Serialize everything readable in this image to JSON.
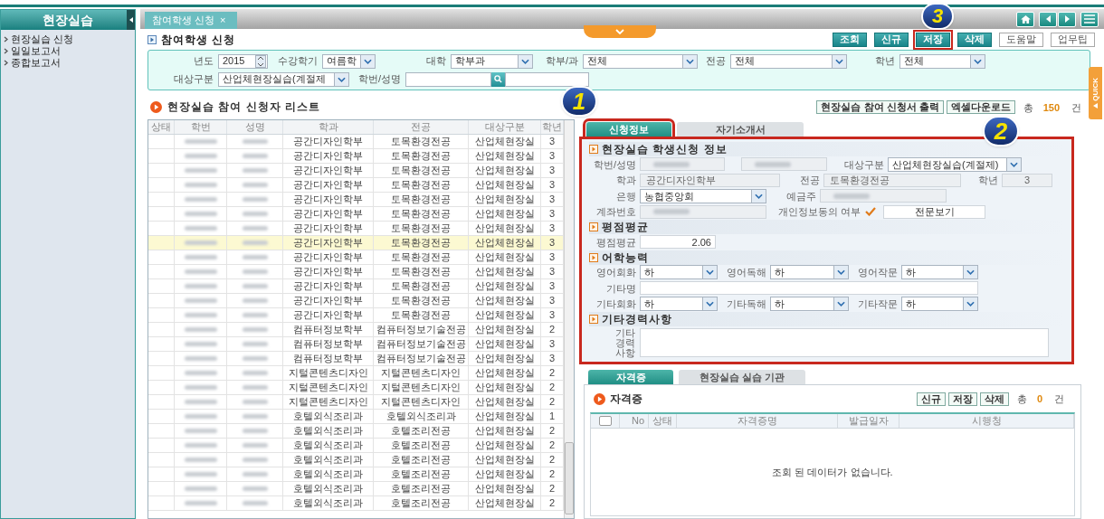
{
  "sidebar": {
    "title": "현장실습",
    "items": [
      {
        "label": "현장실습 신청"
      },
      {
        "label": "일일보고서"
      },
      {
        "label": "종합보고서"
      }
    ]
  },
  "page_tabs": [
    {
      "label": "참여학생 신청",
      "close": "×"
    }
  ],
  "page_title": "참여학생 신청",
  "toolbar_buttons": [
    {
      "label": "조회",
      "kind": "primary",
      "highlighted": false
    },
    {
      "label": "신규",
      "kind": "primary",
      "highlighted": false
    },
    {
      "label": "저장",
      "kind": "primary",
      "highlighted": true
    },
    {
      "label": "삭제",
      "kind": "primary",
      "highlighted": false
    },
    {
      "label": "도움말",
      "kind": "plain",
      "highlighted": false
    },
    {
      "label": "업무팁",
      "kind": "plain",
      "highlighted": false
    }
  ],
  "filters": [
    [
      {
        "label": "년도",
        "kind": "spinner",
        "value": "2015"
      },
      {
        "label": "수강학기",
        "kind": "select",
        "value": "여름학"
      },
      {
        "label": "대학",
        "kind": "select",
        "value": "학부과"
      },
      {
        "label": "학부/과",
        "kind": "select",
        "value": "전체"
      },
      {
        "label": "전공",
        "kind": "select",
        "value": "전체"
      },
      {
        "label": "학년",
        "kind": "select",
        "value": "전체"
      }
    ],
    [
      {
        "label": "대상구분",
        "kind": "select",
        "value": "산업체현장실습(계절제"
      },
      {
        "label": "학번/성명",
        "kind": "search"
      }
    ]
  ],
  "list": {
    "title": "현장실습 참여 신청자 리스트",
    "actions": [
      "현장실습 참여 신청서 출력",
      "엑셀다운로드"
    ],
    "total": {
      "prefix": "총",
      "count": "150",
      "suffix": "건"
    },
    "columns": [
      "상태",
      "학번",
      "성명",
      "학과",
      "전공",
      "대상구분",
      "학년"
    ],
    "rows": [
      {
        "department": "공간디자인학부",
        "major": "토목환경전공",
        "target": "산업체현장실",
        "grade": "3",
        "selected": false
      },
      {
        "department": "공간디자인학부",
        "major": "토목환경전공",
        "target": "산업체현장실",
        "grade": "3",
        "selected": false
      },
      {
        "department": "공간디자인학부",
        "major": "토목환경전공",
        "target": "산업체현장실",
        "grade": "3",
        "selected": false
      },
      {
        "department": "공간디자인학부",
        "major": "토목환경전공",
        "target": "산업체현장실",
        "grade": "3",
        "selected": false
      },
      {
        "department": "공간디자인학부",
        "major": "토목환경전공",
        "target": "산업체현장실",
        "grade": "3",
        "selected": false
      },
      {
        "department": "공간디자인학부",
        "major": "토목환경전공",
        "target": "산업체현장실",
        "grade": "3",
        "selected": false
      },
      {
        "department": "공간디자인학부",
        "major": "토목환경전공",
        "target": "산업체현장실",
        "grade": "3",
        "selected": false
      },
      {
        "department": "공간디자인학부",
        "major": "토목환경전공",
        "target": "산업체현장실",
        "grade": "3",
        "selected": true
      },
      {
        "department": "공간디자인학부",
        "major": "토목환경전공",
        "target": "산업체현장실",
        "grade": "3",
        "selected": false
      },
      {
        "department": "공간디자인학부",
        "major": "토목환경전공",
        "target": "산업체현장실",
        "grade": "3",
        "selected": false
      },
      {
        "department": "공간디자인학부",
        "major": "토목환경전공",
        "target": "산업체현장실",
        "grade": "3",
        "selected": false
      },
      {
        "department": "공간디자인학부",
        "major": "토목환경전공",
        "target": "산업체현장실",
        "grade": "3",
        "selected": false
      },
      {
        "department": "공간디자인학부",
        "major": "토목환경전공",
        "target": "산업체현장실",
        "grade": "3",
        "selected": false
      },
      {
        "department": "컴퓨터정보학부",
        "major": "컴퓨터정보기술전공",
        "target": "산업체현장실",
        "grade": "2",
        "selected": false
      },
      {
        "department": "컴퓨터정보학부",
        "major": "컴퓨터정보기술전공",
        "target": "산업체현장실",
        "grade": "3",
        "selected": false
      },
      {
        "department": "컴퓨터정보학부",
        "major": "컴퓨터정보기술전공",
        "target": "산업체현장실",
        "grade": "3",
        "selected": false
      },
      {
        "department": "지털콘텐츠디자인",
        "major": "지털콘텐츠디자인",
        "target": "산업체현장실",
        "grade": "2",
        "selected": false
      },
      {
        "department": "지털콘텐츠디자인",
        "major": "지털콘텐츠디자인",
        "target": "산업체현장실",
        "grade": "2",
        "selected": false
      },
      {
        "department": "지털콘텐츠디자인",
        "major": "지털콘텐츠디자인",
        "target": "산업체현장실",
        "grade": "2",
        "selected": false
      },
      {
        "department": "호텔외식조리과",
        "major": "호텔외식조리과",
        "target": "산업체현장실",
        "grade": "1",
        "selected": false
      },
      {
        "department": "호텔외식조리과",
        "major": "호텔조리전공",
        "target": "산업체현장실",
        "grade": "2",
        "selected": false
      },
      {
        "department": "호텔외식조리과",
        "major": "호텔조리전공",
        "target": "산업체현장실",
        "grade": "2",
        "selected": false
      },
      {
        "department": "호텔외식조리과",
        "major": "호텔조리전공",
        "target": "산업체현장실",
        "grade": "2",
        "selected": false
      },
      {
        "department": "호텔외식조리과",
        "major": "호텔조리전공",
        "target": "산업체현장실",
        "grade": "2",
        "selected": false
      },
      {
        "department": "호텔외식조리과",
        "major": "호텔조리전공",
        "target": "산업체현장실",
        "grade": "2",
        "selected": false
      },
      {
        "department": "호텔외식조리과",
        "major": "호텔조리전공",
        "target": "산업체현장실",
        "grade": "2",
        "selected": false
      }
    ]
  },
  "detail_tabs": [
    {
      "label": "신청정보",
      "selected": true,
      "highlighted": true
    },
    {
      "label": "자기소개서",
      "selected": false,
      "highlighted": false
    }
  ],
  "form": {
    "highlighted": true,
    "sections": [
      {
        "title": "현장실습 학생신청 정보",
        "rows": [
          [
            {
              "label": "학번/성명",
              "kind": "redacted"
            },
            {
              "kind": "redacted"
            },
            {
              "label": "대상구분",
              "kind": "select",
              "value": "산업체현장실습(계절제)"
            }
          ],
          [
            {
              "label": "학과",
              "kind": "readonly",
              "value": "공간디자인학부"
            },
            {
              "label": "전공",
              "kind": "readonly",
              "value": "토목환경전공"
            },
            {
              "label": "학년",
              "kind": "readonly",
              "value": "3"
            }
          ],
          [
            {
              "label": "은행",
              "kind": "select",
              "value": "농협중앙회"
            },
            {
              "label": "예금주",
              "kind": "redacted"
            }
          ],
          [
            {
              "label": "계좌번호",
              "kind": "redacted"
            },
            {
              "label": "개인정보동의 여부",
              "kind": "check",
              "checked": true
            },
            {
              "kind": "button",
              "value": "전문보기"
            }
          ]
        ]
      },
      {
        "title": "평점평균",
        "rows": [
          [
            {
              "label": "평점평균",
              "kind": "number",
              "value": "2.06"
            }
          ]
        ]
      },
      {
        "title": "어학능력",
        "rows": [
          [
            {
              "label": "영어회화",
              "kind": "select",
              "value": "하"
            },
            {
              "label": "영어독해",
              "kind": "select",
              "value": "하"
            },
            {
              "label": "영어작문",
              "kind": "select",
              "value": "하"
            }
          ],
          [
            {
              "label": "기타명",
              "kind": "text"
            }
          ],
          [
            {
              "label": "기타회화",
              "kind": "select",
              "value": "하"
            },
            {
              "label": "기타독해",
              "kind": "select",
              "value": "하"
            },
            {
              "label": "기타작문",
              "kind": "select",
              "value": "하"
            }
          ]
        ]
      },
      {
        "title": "기타경력사항",
        "rows": [
          [
            {
              "label": "기타 경력 사항",
              "kind": "textarea"
            }
          ]
        ]
      }
    ]
  },
  "sub_tabs": [
    {
      "label": "자격증",
      "selected": true
    },
    {
      "label": "현장실습 실습 기관",
      "selected": false
    }
  ],
  "certificates": {
    "title": "자격증",
    "buttons": [
      "신규",
      "저장",
      "삭제"
    ],
    "total": {
      "prefix": "총",
      "count": "0",
      "suffix": "건"
    },
    "select_all_checked": false,
    "columns": [
      "No",
      "상태",
      "자격증명",
      "발급일자",
      "시행청"
    ],
    "empty_message": "조회 된 데이터가 없습니다."
  },
  "quick_tab": {
    "label": "QUICK"
  },
  "callouts": [
    {
      "number": "1"
    },
    {
      "number": "2"
    },
    {
      "number": "3"
    }
  ]
}
